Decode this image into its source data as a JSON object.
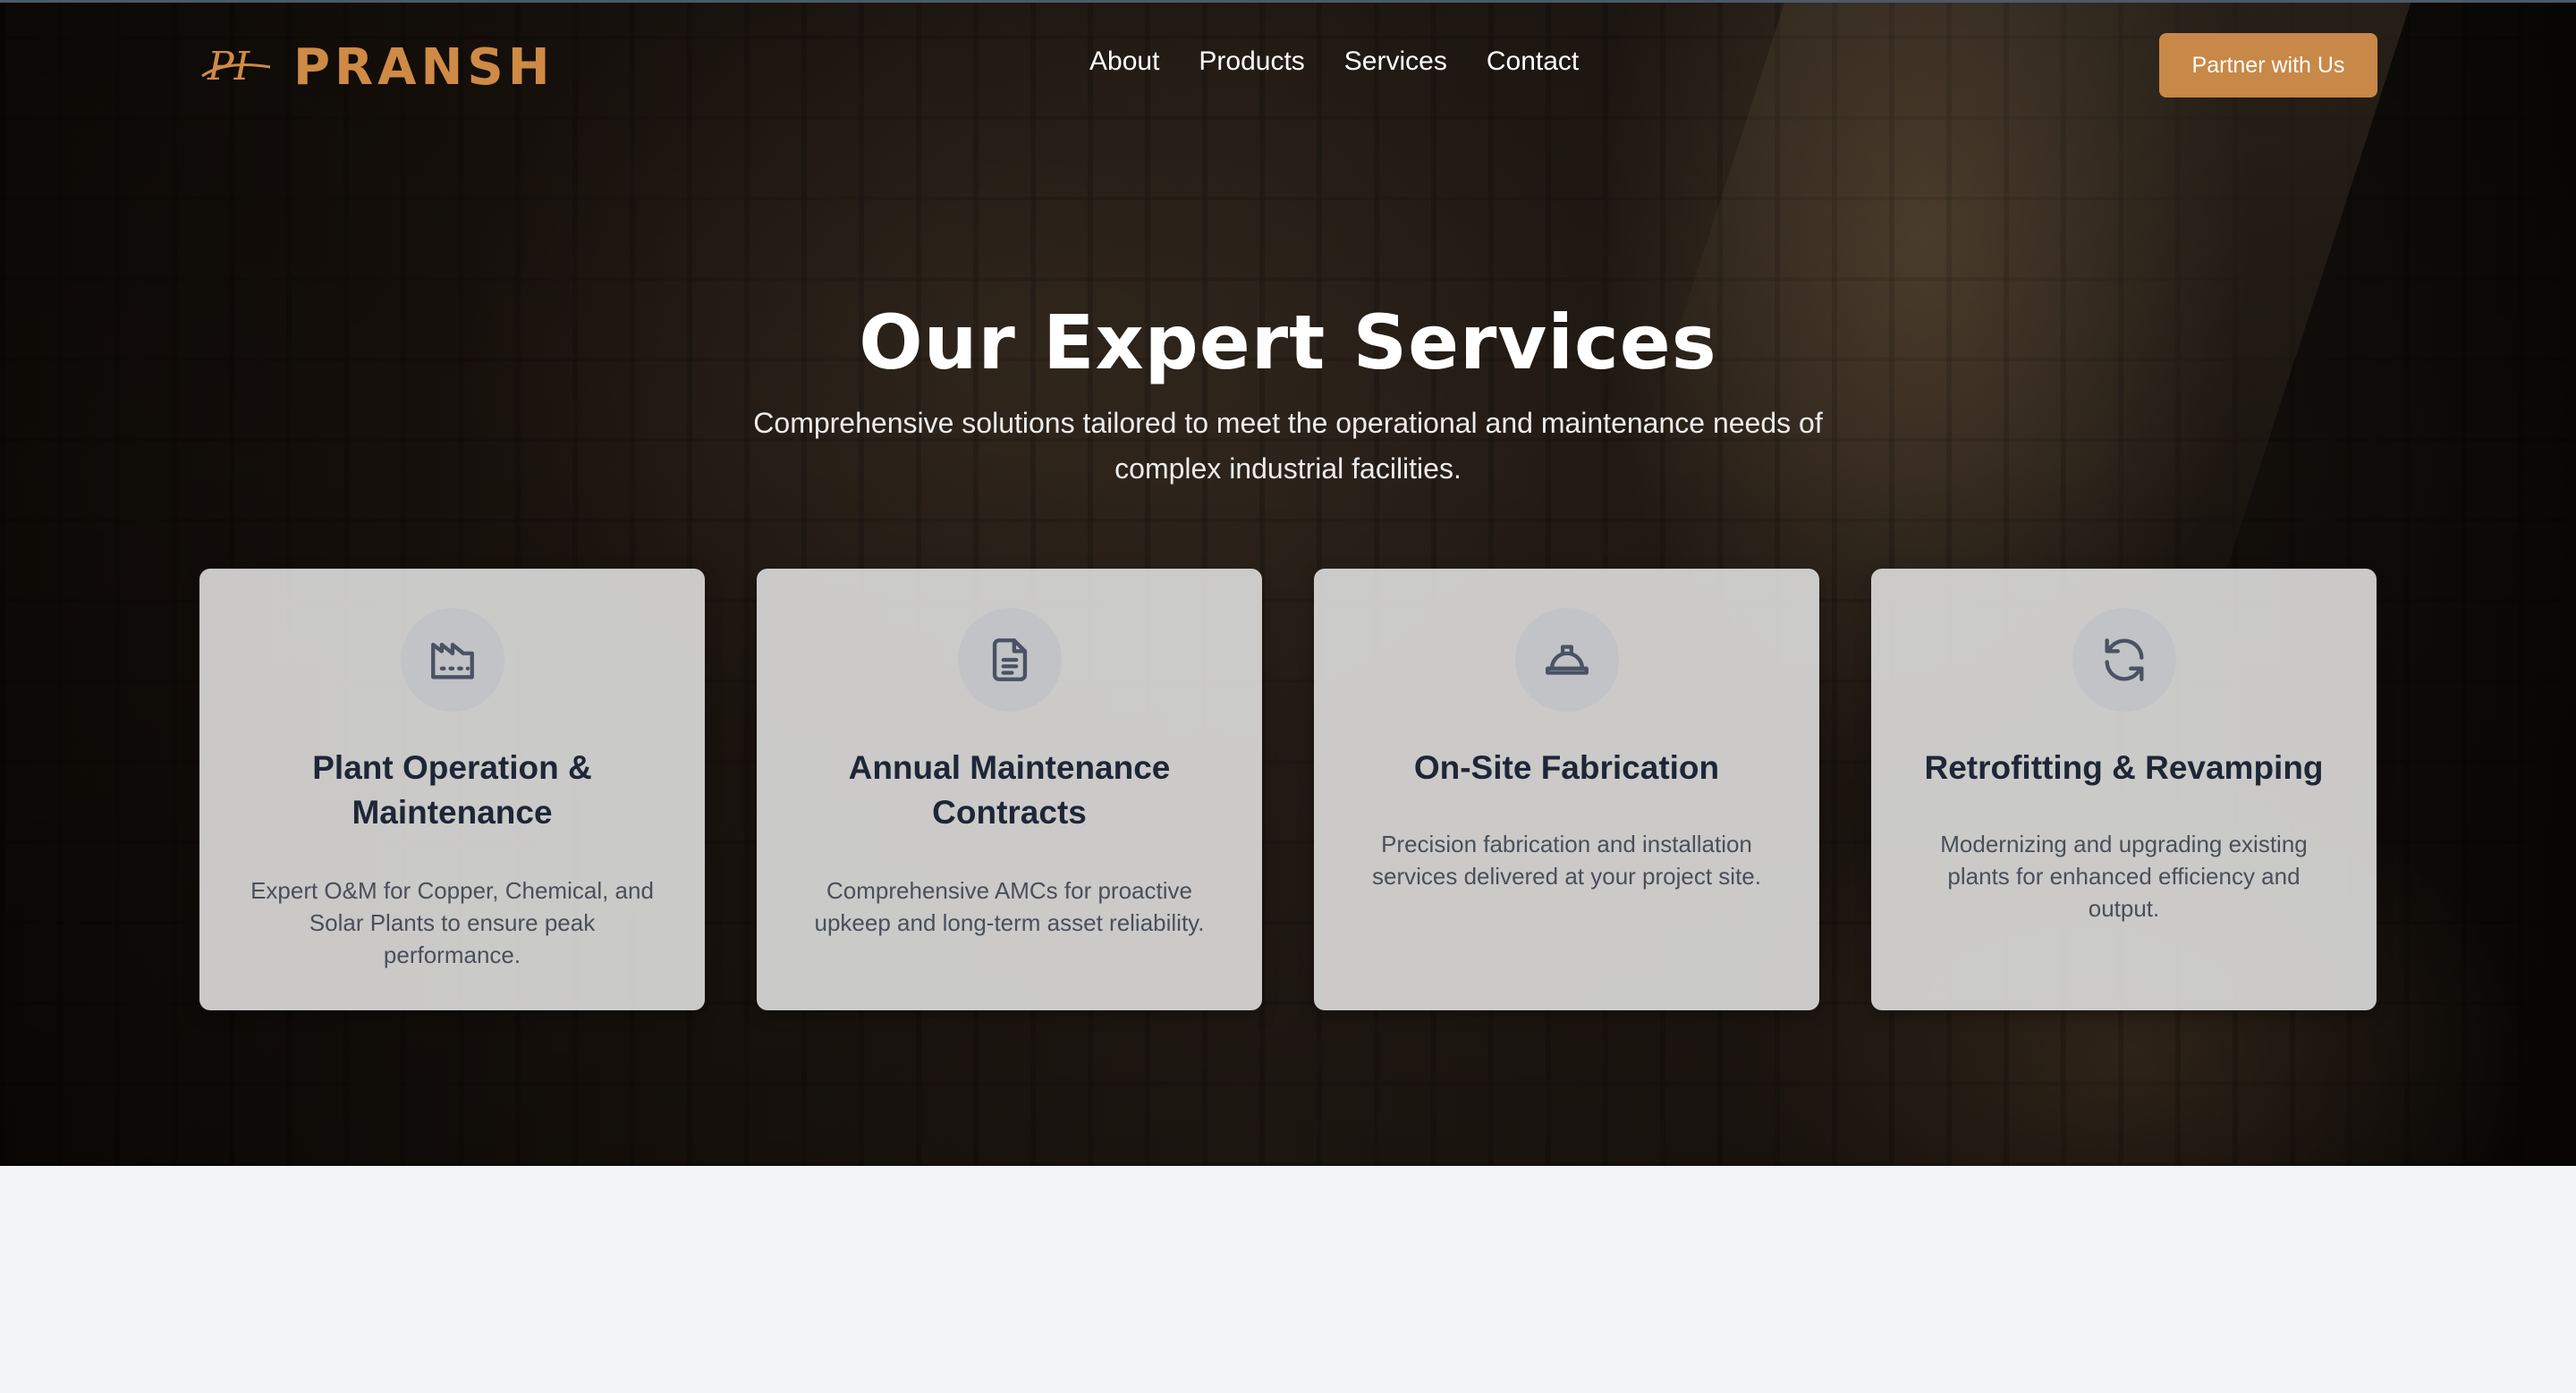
{
  "brand": {
    "logo_mark": "PI",
    "name": "PRANSH",
    "accent_color": "#cf8a45"
  },
  "nav": {
    "links": [
      "About",
      "Products",
      "Services",
      "Contact"
    ],
    "cta_label": "Partner with Us",
    "cta_color": "#c88847"
  },
  "hero": {
    "title": "Our Expert Services",
    "subtitle": "Comprehensive solutions tailored to meet the operational and maintenance needs of complex industrial facilities."
  },
  "services": [
    {
      "icon": "factory-icon",
      "title": "Plant Operation & Maintenance",
      "description": "Expert O&M for Copper, Chemical, and Solar Plants to ensure peak performance."
    },
    {
      "icon": "document-icon",
      "title": "Annual Maintenance Contracts",
      "description": "Comprehensive AMCs for proactive upkeep and long-term asset reliability."
    },
    {
      "icon": "hard-hat-icon",
      "title": "On-Site Fabrication",
      "description": "Precision fabrication and installation services delivered at your project site."
    },
    {
      "icon": "refresh-icon",
      "title": "Retrofitting & Revamping",
      "description": "Modernizing and upgrading existing plants for enhanced efficiency and output."
    }
  ]
}
